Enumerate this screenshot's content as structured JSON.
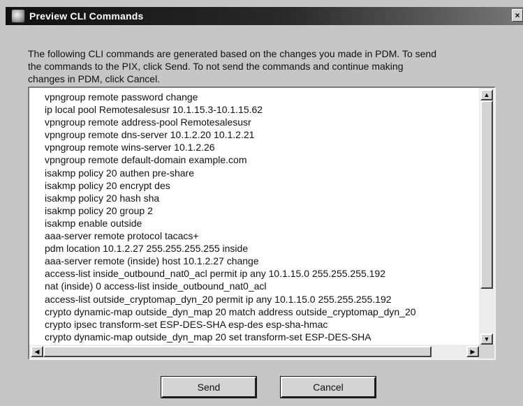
{
  "window": {
    "title": "Preview CLI Commands",
    "close_glyph": "×"
  },
  "message": {
    "lines": [
      "The following CLI commands are generated based on the changes you made in PDM.  To send",
      "the commands to the PIX, click Send.  To not send the commands and continue making",
      "changes in PDM, click Cancel."
    ]
  },
  "commands": [
    "vpngroup remote password change",
    "ip local pool Remotesalesusr 10.1.15.3-10.1.15.62",
    "vpngroup remote address-pool Remotesalesusr",
    "vpngroup remote dns-server 10.1.2.20 10.1.2.21",
    "vpngroup remote wins-server 10.1.2.26",
    "vpngroup remote default-domain example.com",
    "isakmp policy 20 authen pre-share",
    "isakmp policy 20 encrypt des",
    "isakmp policy 20 hash sha",
    "isakmp policy 20 group 2",
    "isakmp enable outside",
    "aaa-server remote protocol tacacs+",
    "pdm location 10.1.2.27 255.255.255.255 inside",
    "aaa-server remote (inside) host 10.1.2.27 change",
    "access-list inside_outbound_nat0_acl permit ip any  10.1.15.0 255.255.255.192",
    "nat (inside) 0 access-list inside_outbound_nat0_acl",
    "access-list outside_cryptomap_dyn_20 permit ip any  10.1.15.0 255.255.255.192",
    "crypto dynamic-map outside_dyn_map 20 match address outside_cryptomap_dyn_20",
    "crypto ipsec transform-set ESP-DES-SHA esp-des esp-sha-hmac",
    "crypto dynamic-map outside_dyn_map 20 set transform-set ESP-DES-SHA"
  ],
  "scroll": {
    "up_glyph": "▲",
    "down_glyph": "▼",
    "left_glyph": "◀",
    "right_glyph": "▶"
  },
  "buttons": {
    "send": "Send",
    "cancel": "Cancel"
  },
  "icons": {
    "app": "preview-app-icon",
    "close": "close-icon"
  }
}
